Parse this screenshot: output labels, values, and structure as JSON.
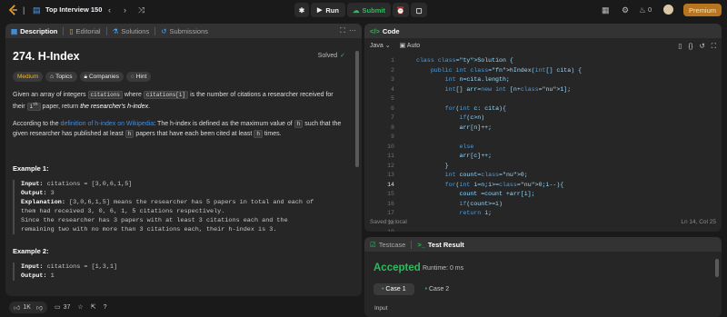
{
  "topbar": {
    "list_name": "Top Interview 150",
    "run_label": "Run",
    "submit_label": "Submit",
    "streak": "0",
    "premium_label": "Premium"
  },
  "left_tabs": [
    "Description",
    "Editorial",
    "Solutions",
    "Submissions"
  ],
  "problem": {
    "title": "274. H-Index",
    "status": "Solved",
    "difficulty": "Medium",
    "chips": [
      "Topics",
      "Companies",
      "Hint"
    ],
    "p1_a": "Given an array of integers",
    "p1_code1": "citations",
    "p1_b": "where",
    "p1_code2": "citations[i]",
    "p1_c": "is the number of citations a researcher received for their",
    "p1_sup": "i",
    "p1_supth": "th",
    "p1_d": "paper, return",
    "p1_em": "the researcher's h-index",
    "p2_a": "According to the",
    "p2_link": "definition of h-index on Wikipedia",
    "p2_b": ": The h-index is defined as the maximum value of",
    "p2_code1": "h",
    "p2_c": "such that the given researcher has published at least",
    "p2_code2": "h",
    "p2_d": "papers that have each been cited at least",
    "p2_code3": "h",
    "p2_e": "times."
  },
  "examples": [
    {
      "title": "Example 1:",
      "input_label": "Input:",
      "input": "citations = [3,0,6,1,5]",
      "output_label": "Output:",
      "output": "3",
      "expl_label": "Explanation:",
      "expl_1": "[3,0,6,1,5] means the researcher has 5 papers in total and each of",
      "expl_2": "them had received 3, 0, 6, 1, 5 citations respectively.",
      "expl_3": "Since the researcher has 3 papers with at least 3 citations each and the",
      "expl_4": "remaining two with no more than 3 citations each, their h-index is 3."
    },
    {
      "title": "Example 2:",
      "input_label": "Input:",
      "input": "citations = [1,3,1]",
      "output_label": "Output:",
      "output": "1"
    }
  ],
  "bottom": {
    "likes": "1K",
    "comments": "37"
  },
  "code_panel": {
    "title": "Code",
    "language": "Java",
    "auto_label": "Auto",
    "saved": "Saved to local",
    "cursor": "Ln 14, Col 25",
    "lines": [
      "class Solution {",
      "    public int hIndex(int[] cita) {",
      "        int n=cita.length;",
      "        int[] arr=new int [n+1];",
      "",
      "        for(int c: cita){",
      "            if(c>n)",
      "            arr[n]++;",
      "",
      "            else",
      "            arr[c]++;",
      "        }",
      "        int count=0;",
      "        for(int i=n;i>=0;i--){",
      "            count =count +arr[i];",
      "            if(count>=i)",
      "            return i;",
      "",
      ""
    ],
    "line_numbers": [
      "1",
      "2",
      "3",
      "4",
      "5",
      "6",
      "7",
      "8",
      "9",
      "10",
      "11",
      "12",
      "13",
      "14",
      "15",
      "16",
      "17",
      "18",
      "19"
    ]
  },
  "result_panel": {
    "tab_testcase": "Testcase",
    "tab_result": "Test Result",
    "accepted": "Accepted",
    "runtime": "Runtime: 0 ms",
    "case1": "Case 1",
    "case2": "Case 2",
    "input_label": "Input"
  },
  "colors": {
    "accent_green": "#2cbb5d",
    "medium": "#ffb800",
    "link": "#3c8ee7",
    "premium": "#b8751f"
  }
}
